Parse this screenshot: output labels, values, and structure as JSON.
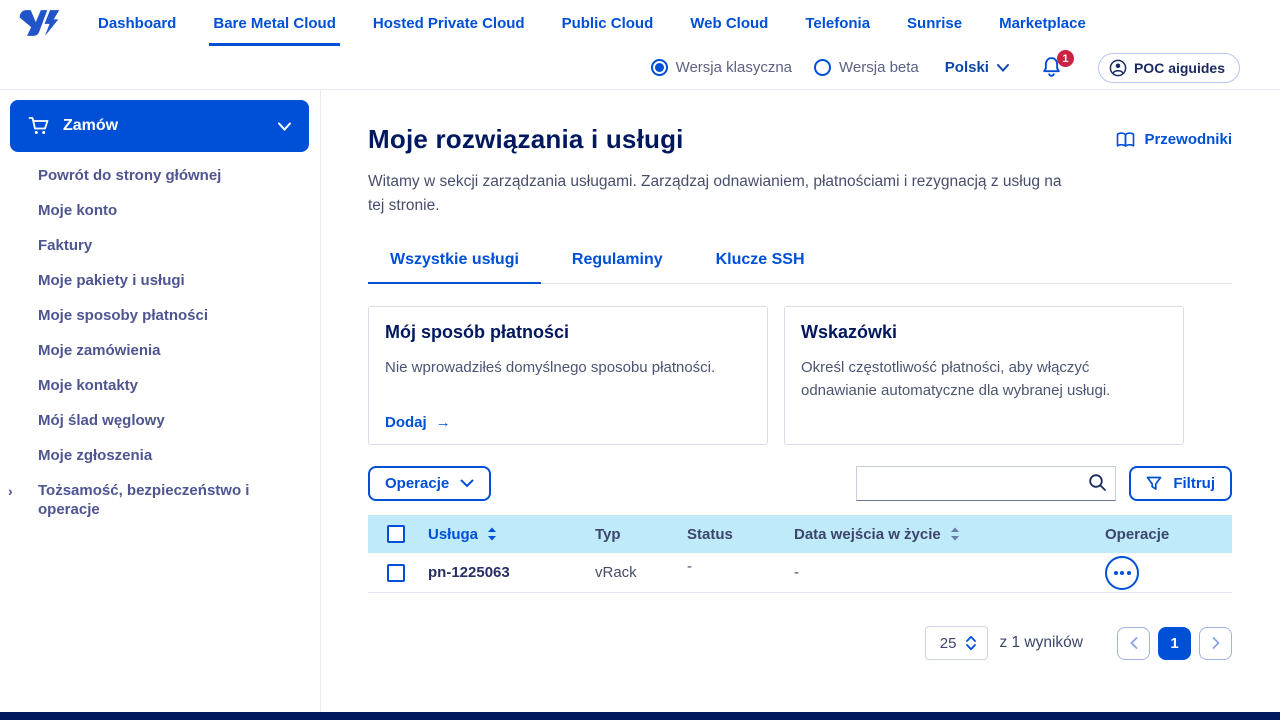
{
  "colors": {
    "primary_blue": "#0050d7",
    "heading_navy": "#00185e",
    "badge_red": "#cd2342",
    "table_header_bg": "#bfeafa"
  },
  "topnav": {
    "items": [
      {
        "label": "Dashboard"
      },
      {
        "label": "Bare Metal Cloud"
      },
      {
        "label": "Hosted Private Cloud"
      },
      {
        "label": "Public Cloud"
      },
      {
        "label": "Web Cloud"
      },
      {
        "label": "Telefonia"
      },
      {
        "label": "Sunrise"
      },
      {
        "label": "Marketplace"
      }
    ],
    "active": "Bare Metal Cloud"
  },
  "header2": {
    "radio_classic": "Wersja klasyczna",
    "radio_beta": "Wersja beta",
    "language": "Polski",
    "notification_count": "1",
    "account": "POC aiguides"
  },
  "sidebar": {
    "order_button": "Zamów",
    "items": [
      {
        "label": "Powrót do strony głównej"
      },
      {
        "label": "Moje konto"
      },
      {
        "label": "Faktury"
      },
      {
        "label": "Moje pakiety i usługi"
      },
      {
        "label": "Moje sposoby płatności"
      },
      {
        "label": "Moje zamówienia"
      },
      {
        "label": "Moje kontakty"
      },
      {
        "label": "Mój ślad węglowy"
      },
      {
        "label": "Moje zgłoszenia"
      }
    ],
    "identity_item": "Tożsamość, bezpieczeństwo i operacje"
  },
  "main": {
    "title": "Moje rozwiązania i usługi",
    "guides_link": "Przewodniki",
    "description": "Witamy w sekcji zarządzania usługami. Zarządzaj odnawianiem, płatnościami i rezygnacją z usług na tej stronie.",
    "tabs": [
      {
        "label": "Wszystkie usługi"
      },
      {
        "label": "Regulaminy"
      },
      {
        "label": "Klucze SSH"
      }
    ],
    "cards": [
      {
        "title": "Mój sposób płatności",
        "body": "Nie wprowadziłeś domyślnego sposobu płatności.",
        "link": "Dodaj",
        "link_arrow": "→"
      },
      {
        "title": "Wskazówki",
        "body": "Określ częstotliwość płatności, aby włączyć odnawianie automatyczne dla wybranej usługi."
      }
    ],
    "operations_button": "Operacje",
    "filter_button": "Filtruj",
    "table": {
      "columns": [
        "Usługa",
        "Typ",
        "Status",
        "Data wejścia w życie",
        "Operacje"
      ],
      "rows": [
        {
          "service": "pn-1225063",
          "type": "vRack",
          "status": "-",
          "date": "-"
        }
      ]
    },
    "pagination": {
      "per_page": "25",
      "results": "z 1 wyników",
      "page": "1"
    }
  }
}
